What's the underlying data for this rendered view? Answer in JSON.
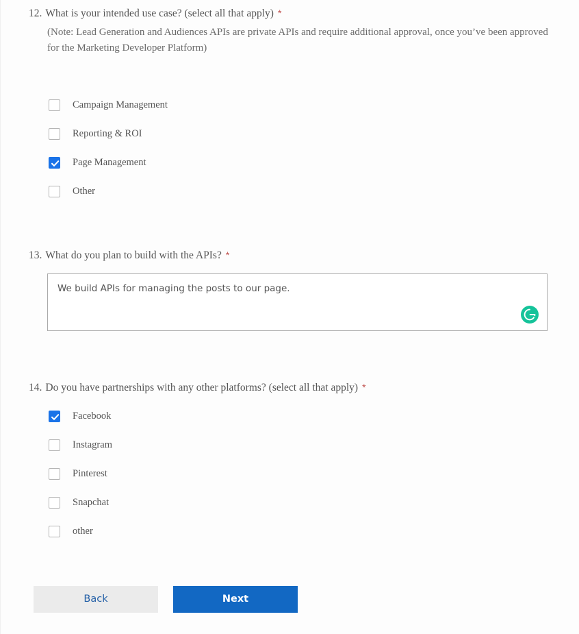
{
  "theme": {
    "accent_blue": "#1268c3",
    "checkbox_blue": "#1a73e8",
    "back_button_bg": "#ebebeb",
    "back_button_text": "#2460a7",
    "required_asterisk": "#c0504d",
    "grammarly_green": "#15c39a"
  },
  "questions": [
    {
      "number": "12.",
      "text": "What is your intended use case? (select all that apply)",
      "required_marker": "*",
      "note": "(Note: Lead Generation and Audiences APIs are private APIs and require additional approval, once you’ve been approved for the Marketing Developer Platform)",
      "options": [
        {
          "label": "Campaign Management",
          "checked": false
        },
        {
          "label": "Reporting & ROI",
          "checked": false
        },
        {
          "label": "Page Management",
          "checked": true
        },
        {
          "label": "Other",
          "checked": false
        }
      ]
    },
    {
      "number": "13.",
      "text": "What do you plan to build with the APIs?",
      "required_marker": "*",
      "answer": {
        "value": "We build APIs for managing the posts to our page.",
        "placeholder": "",
        "assistant_icon": "grammarly-icon"
      }
    },
    {
      "number": "14.",
      "text": "Do you have partnerships with any other platforms? (select all that apply)",
      "required_marker": "*",
      "options": [
        {
          "label": "Facebook",
          "checked": true
        },
        {
          "label": "Instagram",
          "checked": false
        },
        {
          "label": "Pinterest",
          "checked": false
        },
        {
          "label": "Snapchat",
          "checked": false
        },
        {
          "label": "other",
          "checked": false
        }
      ]
    }
  ],
  "footer": {
    "back_label": "Back",
    "next_label": "Next"
  }
}
